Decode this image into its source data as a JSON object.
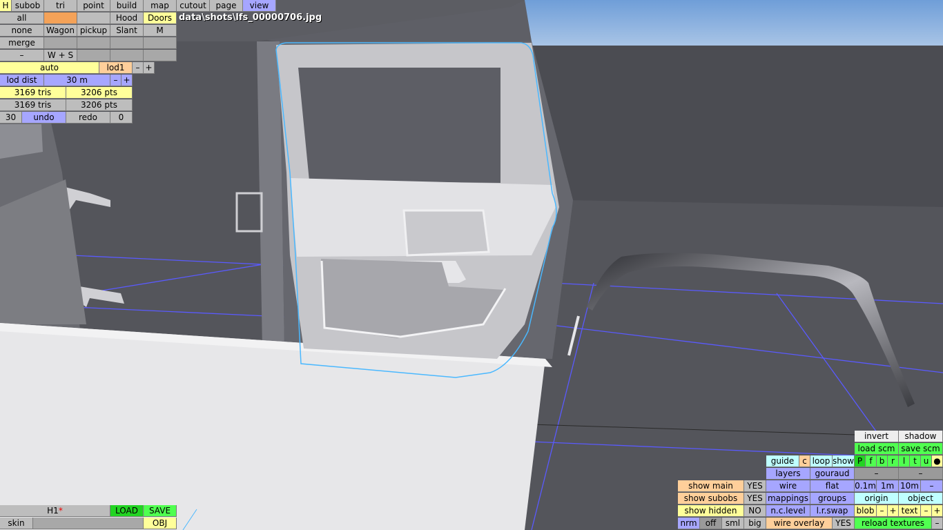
{
  "file": {
    "path": "data\\shots\\lfs_00000706.jpg"
  },
  "toolbar": {
    "row1": [
      "H",
      "subob",
      "tri",
      "point",
      "build",
      "map",
      "cutout",
      "page",
      "view"
    ],
    "row2": [
      "all",
      "",
      "",
      "Hood",
      "Doors"
    ],
    "row3": [
      "none",
      "Wagon",
      "pickup",
      "Slant",
      "M"
    ],
    "row4": [
      "merge"
    ],
    "row5": [
      "–",
      "W + S"
    ]
  },
  "lod": {
    "auto": "auto",
    "lod": "lod1",
    "minus": "–",
    "plus": "+",
    "dist_label": "lod dist",
    "dist_value": "30 m",
    "tris1": "3169 tris",
    "pts1": "3206 pts",
    "tris2": "3169 tris",
    "pts2": "3206 pts"
  },
  "undo": {
    "count": "30",
    "undo": "undo",
    "redo": "redo",
    "redo_count": "0"
  },
  "bottom_left": {
    "name": "H1",
    "star": "*",
    "load": "LOAD",
    "save": "SAVE",
    "skin": "skin",
    "obj": "OBJ"
  },
  "panel": {
    "invert": "invert",
    "shadow": "shadow",
    "load_scm": "load scm",
    "save_scm": "save scm",
    "guide": "guide",
    "c": "c",
    "loop": "loop",
    "show": "show",
    "letters": [
      "P",
      "f",
      "b",
      "r",
      "l",
      "t",
      "u",
      "●"
    ],
    "layers": "layers",
    "gouraud": "gouraud",
    "dash": "–",
    "show_main": "show main",
    "show_main_val": "YES",
    "wire": "wire",
    "flat": "flat",
    "d01": "0.1m",
    "d1": "1m",
    "d10": "10m",
    "show_subobs": "show subobs",
    "show_subobs_val": "YES",
    "mappings": "mappings",
    "groups": "groups",
    "origin": "origin",
    "object": "object",
    "show_hidden": "show hidden",
    "show_hidden_val": "NO",
    "nc_level": "n.c.level",
    "lr_swap": "l.r.swap",
    "blob": "blob",
    "text": "text",
    "plus": "+",
    "nrm": "nrm",
    "off": "off",
    "sml": "sml",
    "big": "big",
    "wire_overlay": "wire overlay",
    "wire_overlay_val": "YES",
    "reload": "reload textures"
  },
  "colors": {
    "accent_yellow": "#ffff9a",
    "accent_purple": "#a6a6ff",
    "accent_green": "#50ff50",
    "accent_orange": "#f4a258",
    "wireframe_blue": "#5a5aff",
    "selection_cyan": "#4ab8ff"
  }
}
